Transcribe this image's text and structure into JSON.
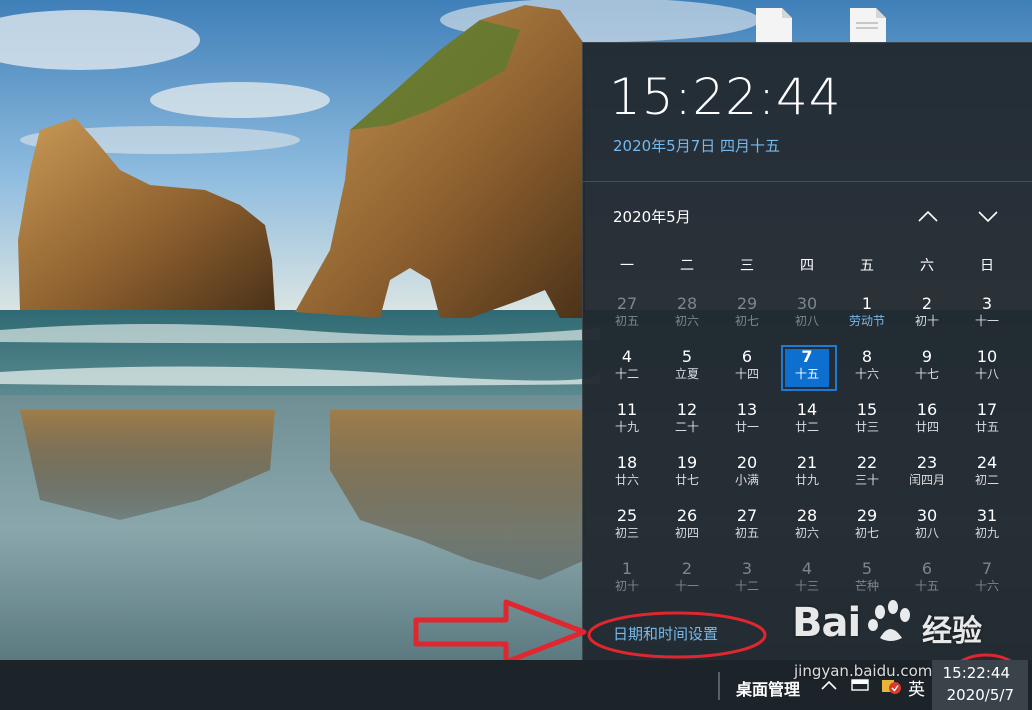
{
  "flyout": {
    "time": "15:22:44",
    "long_date": "2020年5月7日 四月十五",
    "month_label": "2020年5月",
    "nav_up_icon": "chevron-up-icon",
    "nav_down_icon": "chevron-down-icon",
    "weekdays": [
      "一",
      "二",
      "三",
      "四",
      "五",
      "六",
      "日"
    ],
    "days": [
      {
        "num": "27",
        "lunar": "初五",
        "state": "other"
      },
      {
        "num": "28",
        "lunar": "初六",
        "state": "other"
      },
      {
        "num": "29",
        "lunar": "初七",
        "state": "other"
      },
      {
        "num": "30",
        "lunar": "初八",
        "state": "other"
      },
      {
        "num": "1",
        "lunar": "劳动节",
        "state": "holiday"
      },
      {
        "num": "2",
        "lunar": "初十",
        "state": "normal"
      },
      {
        "num": "3",
        "lunar": "十一",
        "state": "normal"
      },
      {
        "num": "4",
        "lunar": "十二",
        "state": "normal"
      },
      {
        "num": "5",
        "lunar": "立夏",
        "state": "normal"
      },
      {
        "num": "6",
        "lunar": "十四",
        "state": "normal"
      },
      {
        "num": "7",
        "lunar": "十五",
        "state": "today"
      },
      {
        "num": "8",
        "lunar": "十六",
        "state": "normal"
      },
      {
        "num": "9",
        "lunar": "十七",
        "state": "normal"
      },
      {
        "num": "10",
        "lunar": "十八",
        "state": "normal"
      },
      {
        "num": "11",
        "lunar": "十九",
        "state": "normal"
      },
      {
        "num": "12",
        "lunar": "二十",
        "state": "normal"
      },
      {
        "num": "13",
        "lunar": "廿一",
        "state": "normal"
      },
      {
        "num": "14",
        "lunar": "廿二",
        "state": "normal"
      },
      {
        "num": "15",
        "lunar": "廿三",
        "state": "normal"
      },
      {
        "num": "16",
        "lunar": "廿四",
        "state": "normal"
      },
      {
        "num": "17",
        "lunar": "廿五",
        "state": "normal"
      },
      {
        "num": "18",
        "lunar": "廿六",
        "state": "normal"
      },
      {
        "num": "19",
        "lunar": "廿七",
        "state": "normal"
      },
      {
        "num": "20",
        "lunar": "小满",
        "state": "normal"
      },
      {
        "num": "21",
        "lunar": "廿九",
        "state": "normal"
      },
      {
        "num": "22",
        "lunar": "三十",
        "state": "normal"
      },
      {
        "num": "23",
        "lunar": "闰四月",
        "state": "normal"
      },
      {
        "num": "24",
        "lunar": "初二",
        "state": "normal"
      },
      {
        "num": "25",
        "lunar": "初三",
        "state": "normal"
      },
      {
        "num": "26",
        "lunar": "初四",
        "state": "normal"
      },
      {
        "num": "27",
        "lunar": "初五",
        "state": "normal"
      },
      {
        "num": "28",
        "lunar": "初六",
        "state": "normal"
      },
      {
        "num": "29",
        "lunar": "初七",
        "state": "normal"
      },
      {
        "num": "30",
        "lunar": "初八",
        "state": "normal"
      },
      {
        "num": "31",
        "lunar": "初九",
        "state": "normal"
      },
      {
        "num": "1",
        "lunar": "初十",
        "state": "other"
      },
      {
        "num": "2",
        "lunar": "十一",
        "state": "other"
      },
      {
        "num": "3",
        "lunar": "十二",
        "state": "other"
      },
      {
        "num": "4",
        "lunar": "十三",
        "state": "other"
      },
      {
        "num": "5",
        "lunar": "芒种",
        "state": "other"
      },
      {
        "num": "6",
        "lunar": "十五",
        "state": "other"
      },
      {
        "num": "7",
        "lunar": "十六",
        "state": "other"
      }
    ],
    "settings_link": "日期和时间设置"
  },
  "taskbar": {
    "desktop_label": "桌面管理",
    "ime_label": "英",
    "clock_time": "15:22:44",
    "clock_date": "2020/5/7",
    "icons": [
      "chevron-up-icon",
      "keyboard-icon",
      "security-shield-icon"
    ]
  },
  "watermark": {
    "logo_text": "Bai",
    "logo_text2": "经验",
    "url": "jingyan.baidu.com"
  },
  "colors": {
    "accent": "#0d6fd0",
    "link": "#76b9ed",
    "annotation": "#e0262e",
    "flyout_bg": "#21282e",
    "taskbar_bg": "#1c2329"
  }
}
